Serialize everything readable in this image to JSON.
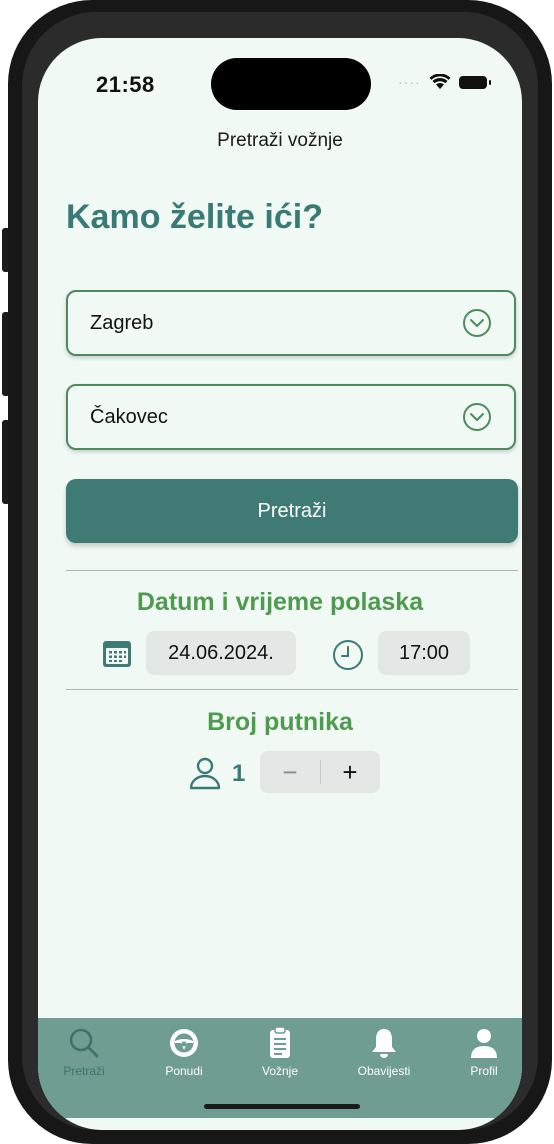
{
  "status_bar": {
    "time": "21:58"
  },
  "nav": {
    "title": "Pretraži vožnje"
  },
  "main": {
    "heading": "Kamo želite ići?",
    "from_field": {
      "value": "Zagreb"
    },
    "to_field": {
      "value": "Čakovec"
    },
    "search_button": "Pretraži",
    "datetime": {
      "title": "Datum i vrijeme polaska",
      "date": "24.06.2024.",
      "time": "17:00"
    },
    "passengers": {
      "title": "Broj putnika",
      "count": "1",
      "minus": "−",
      "plus": "+"
    }
  },
  "tabbar": {
    "items": [
      {
        "label": "Pretraži",
        "icon": "search-icon",
        "active": true
      },
      {
        "label": "Ponudi",
        "icon": "steering-wheel-icon",
        "active": false
      },
      {
        "label": "Vožnje",
        "icon": "clipboard-icon",
        "active": false
      },
      {
        "label": "Obavijesti",
        "icon": "bell-icon",
        "active": false
      },
      {
        "label": "Profil",
        "icon": "person-icon",
        "active": false
      }
    ]
  },
  "colors": {
    "accent": "#3f7b74",
    "heading": "#3a7a74",
    "section_title": "#4e9b4f",
    "field_border": "#4e8a5d",
    "background": "#f1f9f5",
    "tabbar": "#6f9d92"
  }
}
